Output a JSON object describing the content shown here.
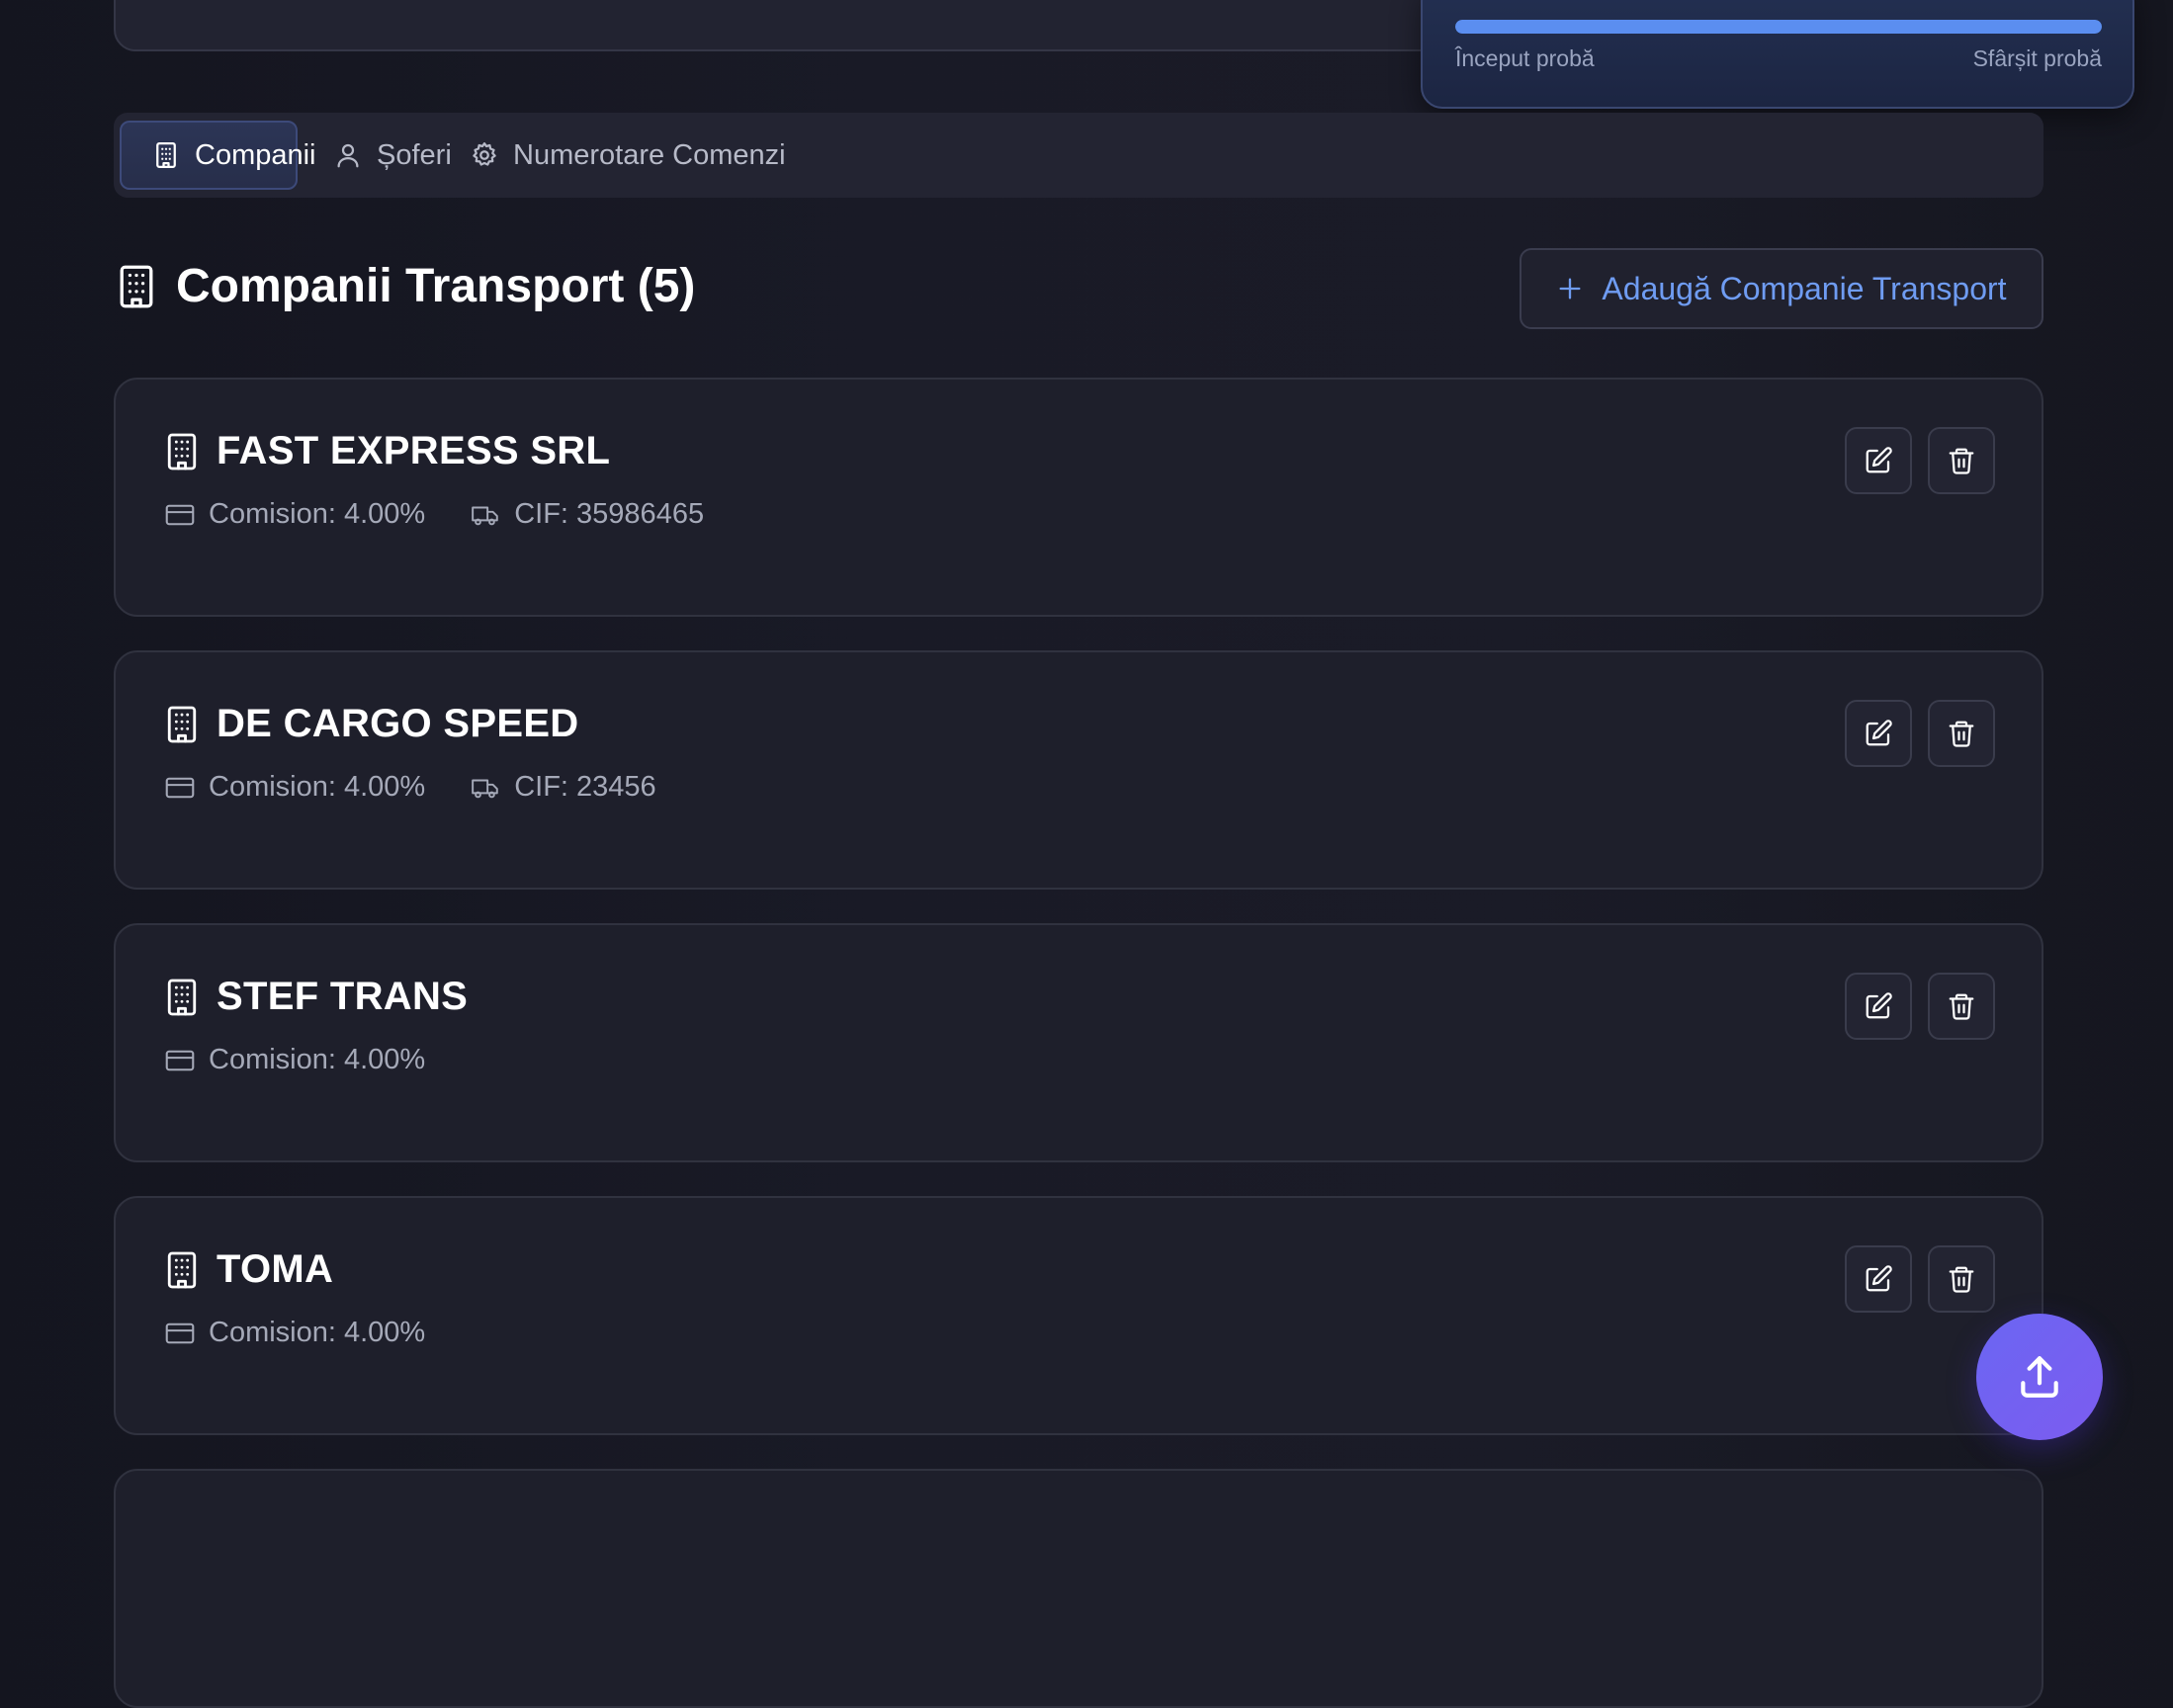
{
  "trial": {
    "start_label": "Început probă",
    "end_label": "Sfârșit probă",
    "progress_percent": 100
  },
  "tabs": [
    {
      "label": "Companii",
      "icon": "building-icon",
      "active": true
    },
    {
      "label": "Șoferi",
      "icon": "user-icon",
      "active": false
    },
    {
      "label": "Numerotare Comenzi",
      "icon": "gear-icon",
      "active": false
    }
  ],
  "section": {
    "title": "Companii Transport (5)",
    "add_button_label": "Adaugă Companie Transport"
  },
  "companies": [
    {
      "name": "FAST EXPRESS SRL",
      "commission": "Comision: 4.00%",
      "cif": "CIF: 35986465"
    },
    {
      "name": "DE CARGO SPEED",
      "commission": "Comision: 4.00%",
      "cif": "CIF: 23456"
    },
    {
      "name": "STEF TRANS",
      "commission": "Comision: 4.00%"
    },
    {
      "name": "TOMA",
      "commission": "Comision: 4.00%"
    }
  ],
  "colors": {
    "accent": "#6f9cf2",
    "progress": "#5b8ef0",
    "fab": "#7163f1",
    "background": "#191a26",
    "card": "#1e1f2b"
  }
}
